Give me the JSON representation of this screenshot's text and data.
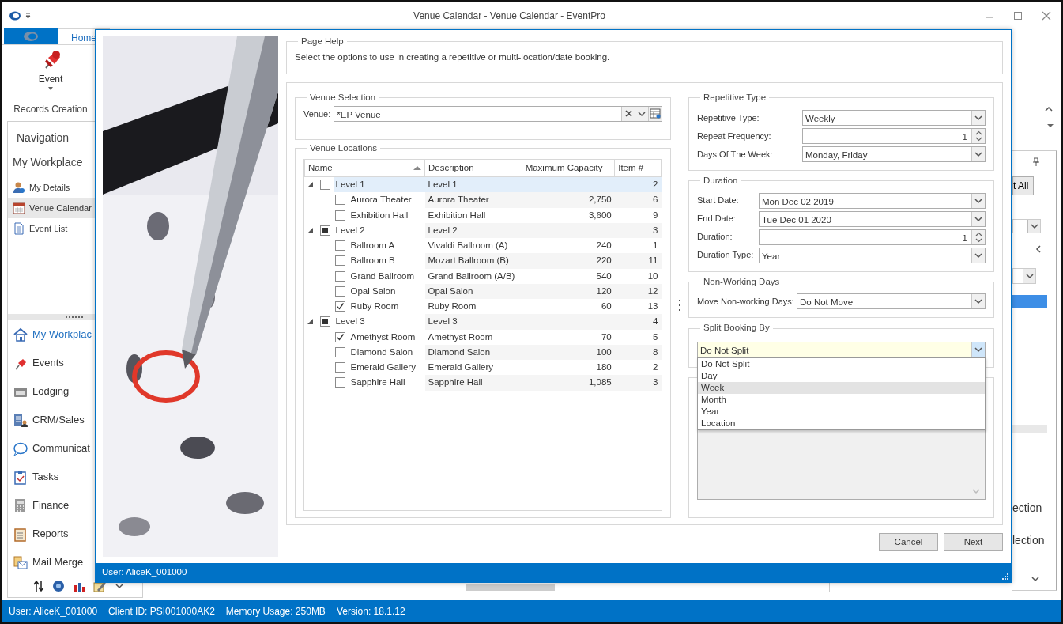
{
  "window": {
    "title": "Venue Calendar - Venue Calendar - EventPro"
  },
  "ribbon": {
    "tabs": [
      {
        "label": "Home",
        "selected": true
      }
    ],
    "buttons": [
      {
        "label": "Event"
      }
    ],
    "group_label": "Records Creation"
  },
  "navigation": {
    "title": "Navigation",
    "section_title": "My Workplace",
    "items": [
      {
        "label": "My Details",
        "selected": false
      },
      {
        "label": "Venue Calendar",
        "selected": true
      },
      {
        "label": "Event List",
        "selected": false
      }
    ],
    "modules": [
      {
        "label": "My Workplac",
        "selected": true
      },
      {
        "label": "Events",
        "selected": false
      },
      {
        "label": "Lodging",
        "selected": false
      },
      {
        "label": "CRM/Sales",
        "selected": false
      },
      {
        "label": "Communicat",
        "selected": false
      },
      {
        "label": "Tasks",
        "selected": false
      },
      {
        "label": "Finance",
        "selected": false
      },
      {
        "label": "Reports",
        "selected": false
      },
      {
        "label": "Mail Merge",
        "selected": false
      }
    ]
  },
  "side_panel": {
    "button": "t All",
    "texts": [
      "ection",
      "lection"
    ]
  },
  "dialog": {
    "page_help": {
      "title": "Page Help",
      "text": "Select the options to use in creating a repetitive or multi-location/date booking."
    },
    "venue_selection": {
      "title": "Venue Selection",
      "label": "Venue:",
      "value": "*EP Venue"
    },
    "venue_locations": {
      "title": "Venue Locations",
      "columns": [
        {
          "label": "Name",
          "sorted": true
        },
        {
          "label": "Description",
          "sorted": false
        },
        {
          "label": "Maximum Capacity",
          "sorted": false
        },
        {
          "label": "Item #",
          "sorted": false
        }
      ],
      "groups": [
        {
          "name": "Level 1",
          "description": "Level 1",
          "item": "2",
          "checked": false,
          "indeterminate": false,
          "expanded": true,
          "selected": true,
          "children": [
            {
              "name": "Aurora Theater",
              "description": "Aurora Theater",
              "capacity": "2,750",
              "item": "6",
              "checked": false
            },
            {
              "name": "Exhibition Hall",
              "description": "Exhibition Hall",
              "capacity": "3,600",
              "item": "9",
              "checked": false
            }
          ]
        },
        {
          "name": "Level 2",
          "description": "Level 2",
          "item": "3",
          "checked": false,
          "indeterminate": true,
          "expanded": true,
          "selected": false,
          "children": [
            {
              "name": "Ballroom A",
              "description": "Vivaldi Ballroom (A)",
              "capacity": "240",
              "item": "1",
              "checked": false
            },
            {
              "name": "Ballroom B",
              "description": "Mozart Ballroom (B)",
              "capacity": "220",
              "item": "11",
              "checked": false
            },
            {
              "name": "Grand Ballroom",
              "description": "Grand Ballroom (A/B)",
              "capacity": "540",
              "item": "10",
              "checked": false
            },
            {
              "name": "Opal Salon",
              "description": "Opal Salon",
              "capacity": "120",
              "item": "12",
              "checked": false
            },
            {
              "name": "Ruby Room",
              "description": "Ruby Room",
              "capacity": "60",
              "item": "13",
              "checked": true
            }
          ]
        },
        {
          "name": "Level 3",
          "description": "Level 3",
          "item": "4",
          "checked": false,
          "indeterminate": true,
          "expanded": true,
          "selected": false,
          "children": [
            {
              "name": "Amethyst Room",
              "description": "Amethyst Room",
              "capacity": "70",
              "item": "5",
              "checked": true
            },
            {
              "name": "Diamond Salon",
              "description": "Diamond Salon",
              "capacity": "100",
              "item": "8",
              "checked": false
            },
            {
              "name": "Emerald Gallery",
              "description": "Emerald Gallery",
              "capacity": "180",
              "item": "2",
              "checked": false
            },
            {
              "name": "Sapphire Hall",
              "description": "Sapphire Hall",
              "capacity": "1,085",
              "item": "3",
              "checked": false
            }
          ]
        }
      ]
    },
    "sections": [
      {
        "title": "Repetitive Type",
        "fields": [
          {
            "label": "Repetitive Type:",
            "value": "Weekly",
            "kind": "combo"
          },
          {
            "label": "Repeat Frequency:",
            "value": "1",
            "kind": "spin"
          },
          {
            "label": "Days Of The Week:",
            "value": "Monday, Friday",
            "kind": "combo"
          }
        ]
      },
      {
        "title": "Duration",
        "fields": [
          {
            "label": "Start Date:",
            "value": "Mon Dec 02 2019",
            "kind": "combo"
          },
          {
            "label": "End Date:",
            "value": "Tue Dec 01 2020",
            "kind": "combo"
          },
          {
            "label": "Duration:",
            "value": "1",
            "kind": "spin"
          },
          {
            "label": "Duration Type:",
            "value": "Year",
            "kind": "combo"
          }
        ]
      },
      {
        "title": "Non-Working Days",
        "fields": [
          {
            "label": "Move Non-working Days:",
            "value": "Do Not Move",
            "kind": "combo"
          }
        ]
      }
    ],
    "split_booking": {
      "title": "Split Booking By",
      "value": "Do Not Split",
      "expanded": true,
      "options": [
        {
          "label": "Do Not Split",
          "highlighted": false
        },
        {
          "label": "Day",
          "highlighted": false
        },
        {
          "label": "Week",
          "highlighted": true
        },
        {
          "label": "Month",
          "highlighted": false
        },
        {
          "label": "Year",
          "highlighted": false
        },
        {
          "label": "Location",
          "highlighted": false
        }
      ]
    },
    "buttons": [
      {
        "label": "Cancel"
      },
      {
        "label": "Next"
      }
    ],
    "status": "User: AliceK_001000"
  },
  "status_bar": {
    "items": [
      "User: AliceK_001000",
      "Client ID: PSI001000AK2",
      "Memory Usage: 250MB",
      "Version: 18.1.12"
    ]
  }
}
